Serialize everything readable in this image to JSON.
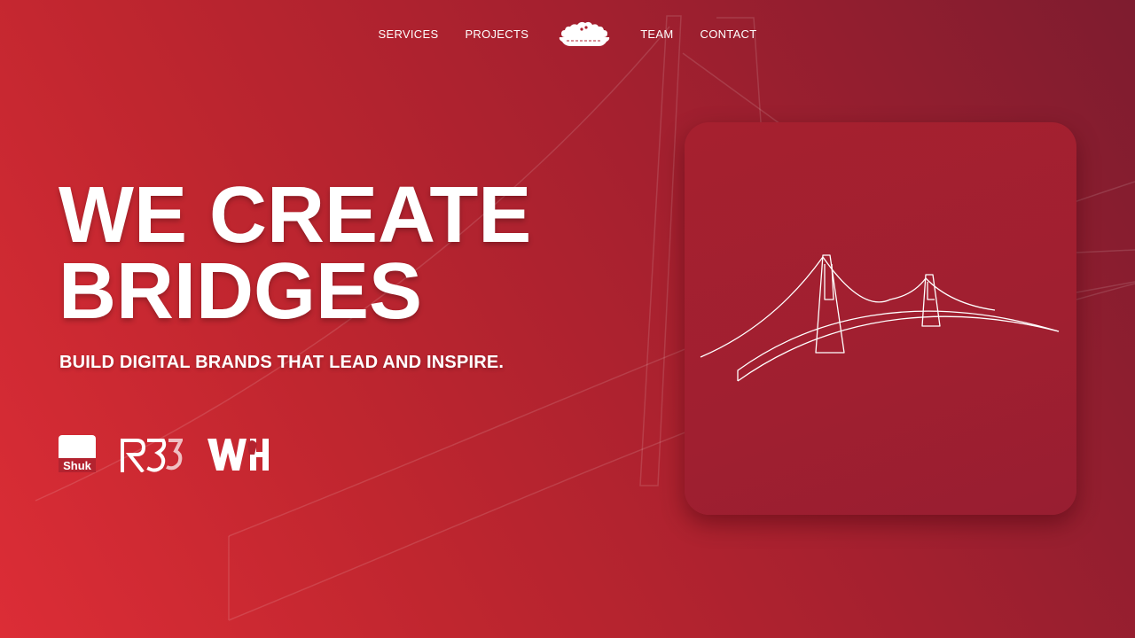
{
  "nav": {
    "items": [
      "SERVICES",
      "PROJECTS",
      "TEAM",
      "CONTACT"
    ],
    "logo_icon": "pie-cake-logo-icon"
  },
  "hero": {
    "title_line1": "WE CREATE",
    "title_line2": "BRIDGES",
    "subtitle": "BUILD DIGITAL BRANDS THAT LEAD AND INSPIRE."
  },
  "brands": [
    "Shuk",
    "R35",
    "WH"
  ],
  "card": {
    "illustration": "bridge-line-icon"
  },
  "colors": {
    "gradient_start": "#dc2d36",
    "gradient_end": "#7e1c2f",
    "card": "#a01f30",
    "text": "#ffffff"
  }
}
